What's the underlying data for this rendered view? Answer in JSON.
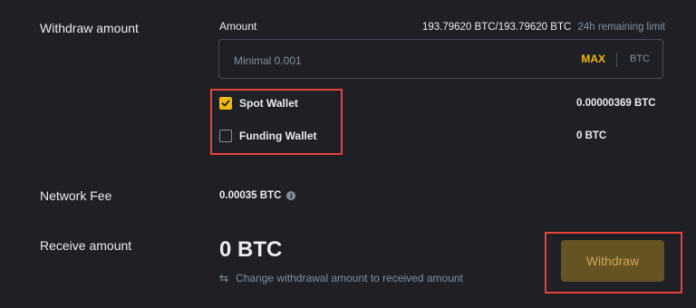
{
  "section": {
    "withdraw_amount_label": "Withdraw amount",
    "amount_label": "Amount",
    "limit_value": "193.79620 BTC/193.79620 BTC",
    "limit_sub": "24h remaining limit",
    "input_placeholder": "Minimal 0.001",
    "max_label": "MAX",
    "coin": "BTC"
  },
  "wallets": [
    {
      "label": "Spot Wallet",
      "checked": true,
      "balance": "0.00000369 BTC"
    },
    {
      "label": "Funding Wallet",
      "checked": false,
      "balance": "0 BTC"
    }
  ],
  "fee": {
    "label": "Network Fee",
    "value": "0.00035 BTC",
    "info_icon": "i"
  },
  "receive": {
    "label": "Receive amount",
    "value": "0 BTC",
    "hint": "Change withdrawal amount to received amount"
  },
  "actions": {
    "withdraw_label": "Withdraw"
  },
  "colors": {
    "background": "#1e2026",
    "accent": "#f0b90b",
    "highlight": "#e8413a",
    "withdraw_button_bg": "#655324"
  },
  "icons": {
    "check": "check-icon",
    "info": "info-icon",
    "swap": "swap-icon"
  }
}
